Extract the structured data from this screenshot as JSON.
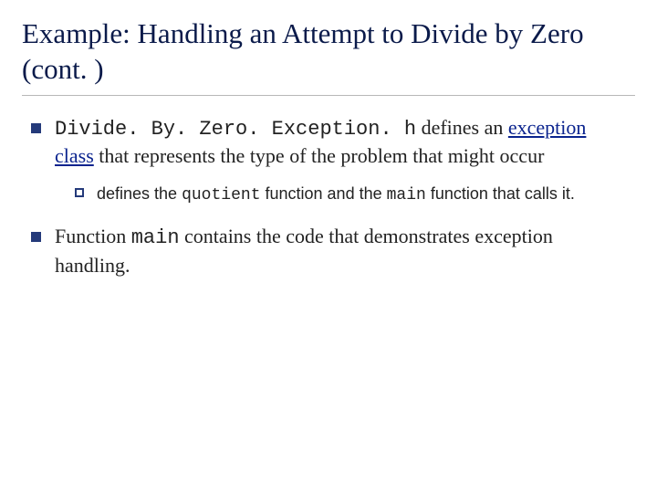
{
  "title": "Example: Handling an Attempt to Divide by Zero (cont. )",
  "bullets": [
    {
      "code1": "Divide. By. Zero. Exception. h",
      "text1": " defines an ",
      "link1": "exception class",
      "text2": " that represents the type of the problem that might occur",
      "sub": [
        {
          "text1": "defines the ",
          "code1": "quotient",
          "text2": " function and the ",
          "code2": "main",
          "text3": " function that calls it."
        }
      ]
    },
    {
      "text1": "Function ",
      "code1": "main",
      "text2": " contains the code that demonstrates exception handling."
    }
  ]
}
